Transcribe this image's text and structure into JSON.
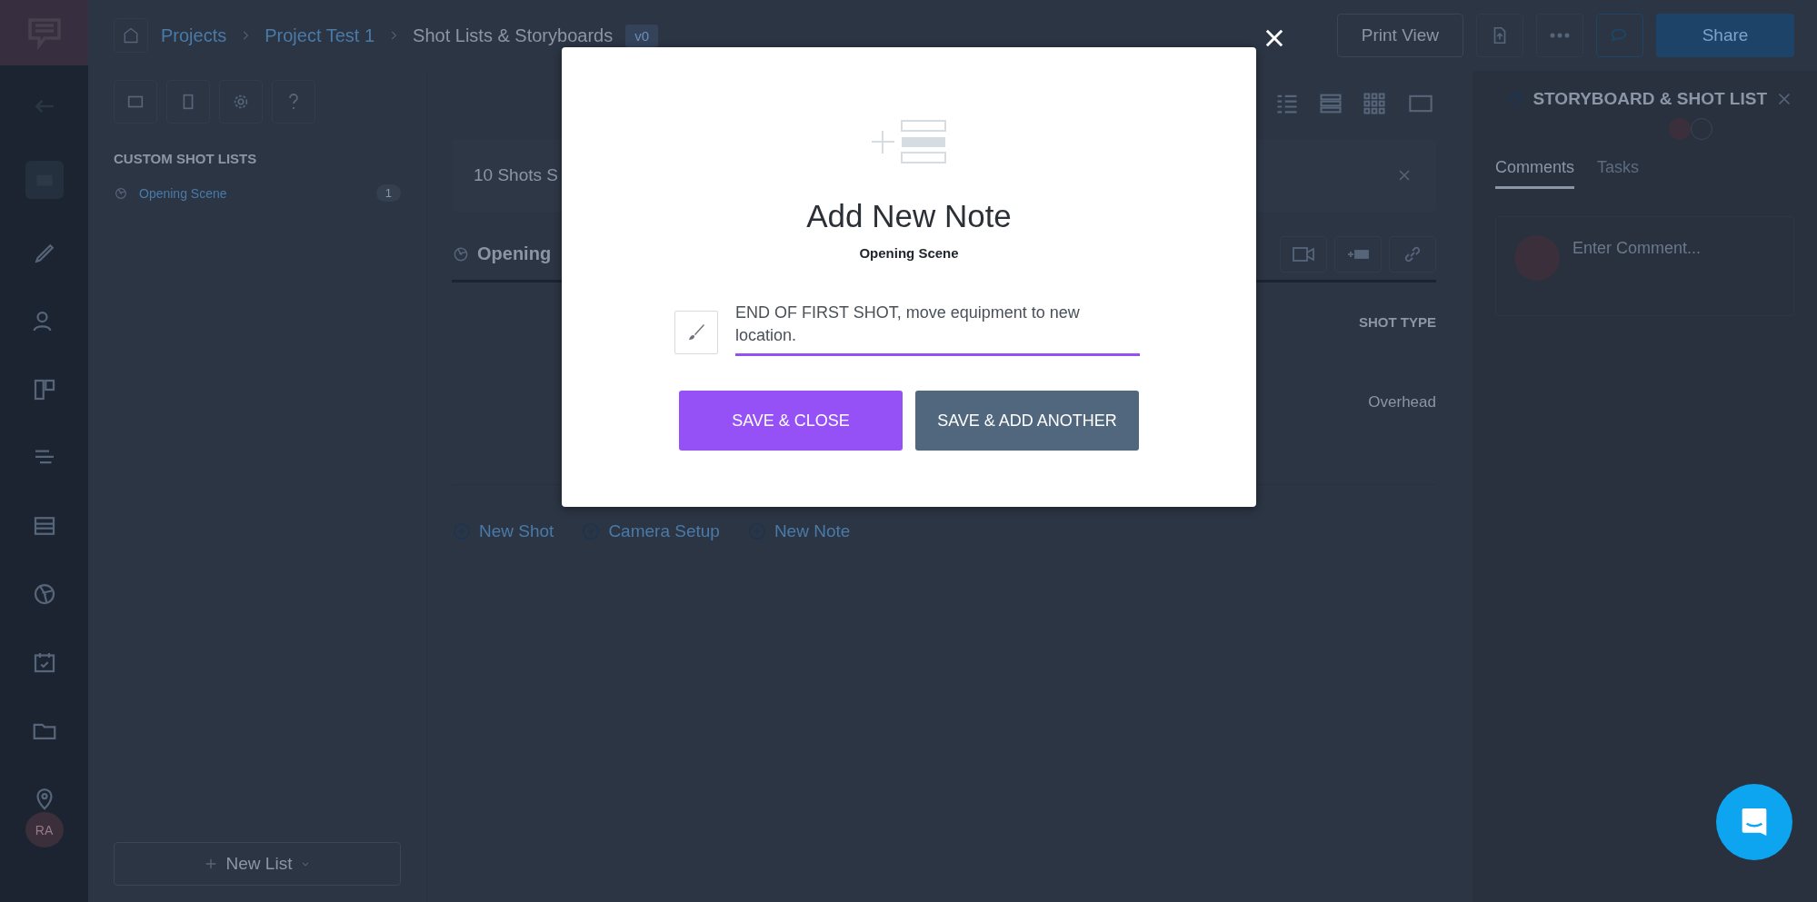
{
  "sidebar": {
    "avatar": "RA"
  },
  "breadcrumbs": [
    {
      "label": "Projects",
      "link": true
    },
    {
      "label": "Project Test 1",
      "link": true
    },
    {
      "label": "Shot Lists & Storyboards",
      "link": false
    }
  ],
  "version": "v0",
  "top_actions": {
    "print": "Print View",
    "share": "Share"
  },
  "left_panel": {
    "heading": "CUSTOM SHOT LISTS",
    "lists": [
      {
        "name": "Opening Scene",
        "count": "1",
        "selected": true
      }
    ],
    "new_list": "New List"
  },
  "main": {
    "summary": "10 Shots S",
    "scene_title": "Opening",
    "column": "SHOT TYPE",
    "cell": "Overhead",
    "add_links": [
      "New Shot",
      "Camera Setup",
      "New Note"
    ]
  },
  "right_panel": {
    "title": "STORYBOARD & SHOT LIST",
    "tabs": [
      {
        "label": "Comments",
        "selected": true
      },
      {
        "label": "Tasks",
        "selected": false
      }
    ],
    "comment_placeholder": "Enter Comment..."
  },
  "modal": {
    "title": "Add New Note",
    "subtitle": "Opening Scene",
    "note": "END OF FIRST SHOT, move equipment to new location.",
    "buttons": [
      {
        "label": "SAVE & CLOSE",
        "kind": "primary"
      },
      {
        "label": "SAVE & ADD ANOTHER",
        "kind": "secondary"
      }
    ]
  }
}
